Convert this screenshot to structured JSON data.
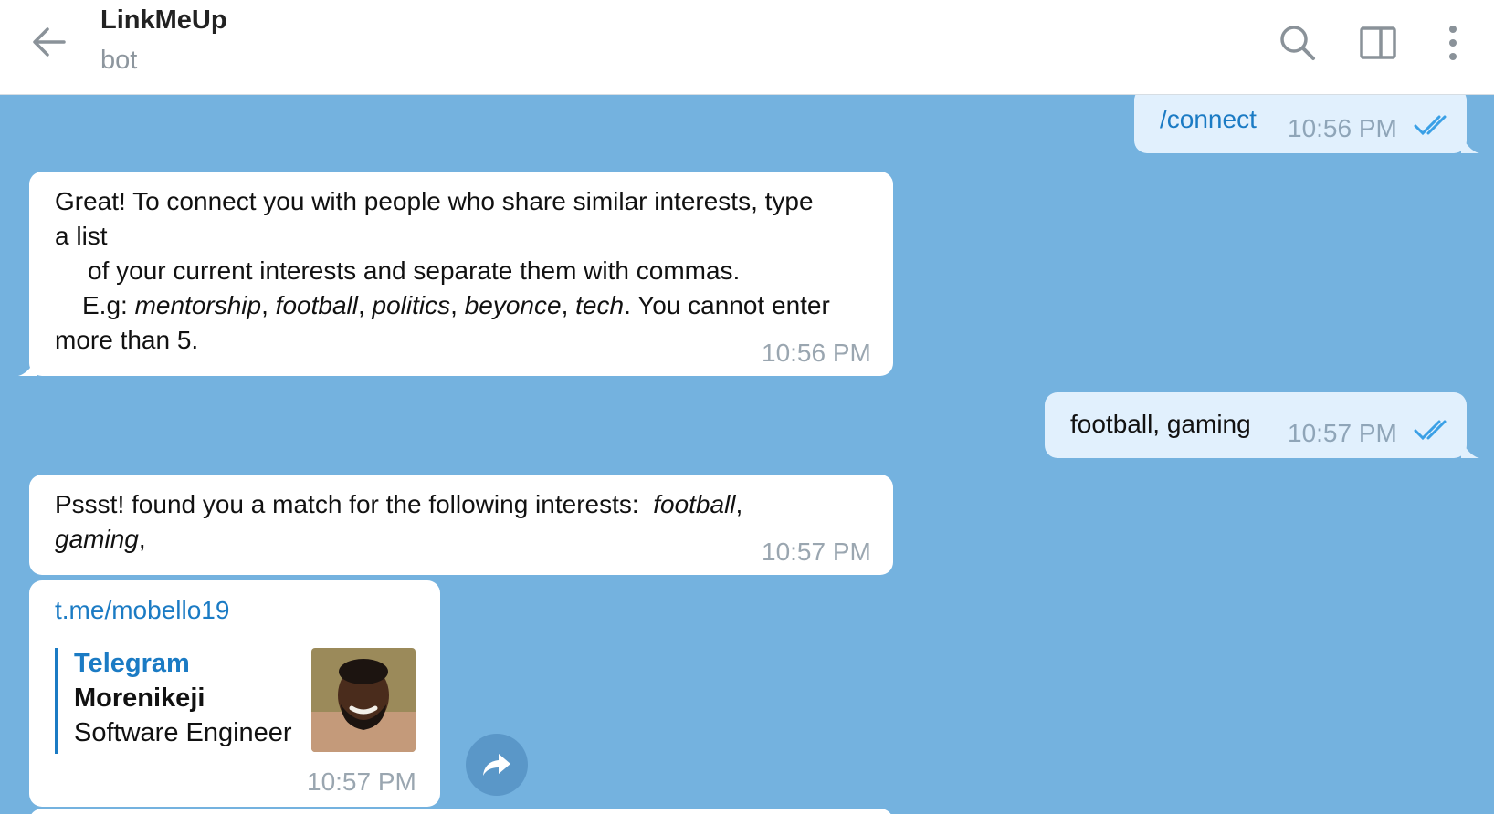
{
  "header": {
    "title": "LinkMeUp",
    "subtitle": "bot"
  },
  "messages": {
    "m1": {
      "text": "/connect",
      "time": "10:56 PM"
    },
    "m2": {
      "line1": "Great! To connect you with people who share similar interests, type",
      "line2": "a list",
      "line3": "of your current interests and separate them with commas.",
      "line4_prefix": "E.g: ",
      "ex1": "mentorship",
      "ex2": "football",
      "ex3": "politics",
      "ex4": "beyonce",
      "ex5": "tech",
      "line4_suffix": ". You cannot enter",
      "line5": "more than 5.",
      "time": "10:56 PM"
    },
    "m3": {
      "text": "football, gaming",
      "time": "10:57 PM"
    },
    "m4": {
      "prefix": "Pssst! found you a match for the following interests:",
      "interest1": "football",
      "interest2": "gaming",
      "time": "10:57 PM"
    },
    "m5": {
      "link": "t.me/mobello19",
      "site": "Telegram",
      "name": "Morenikeji",
      "description": "Software Engineer",
      "time": "10:57 PM"
    }
  },
  "colors": {
    "chat_background": "#74b2df",
    "link": "#1b7bc4",
    "outgoing_bubble": "#e1f0fd"
  }
}
